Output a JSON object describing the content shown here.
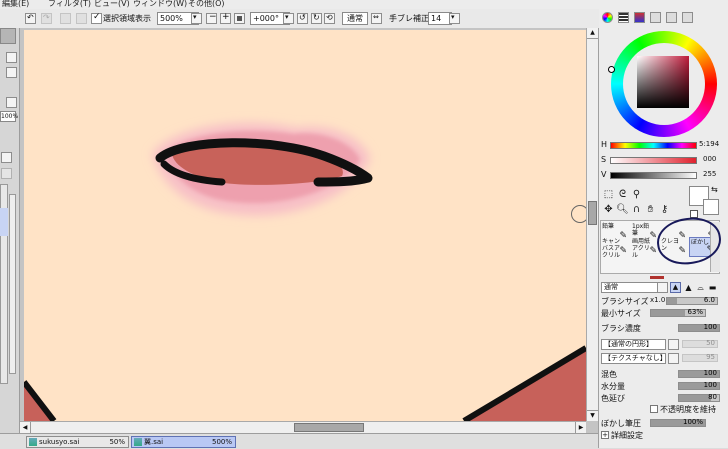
{
  "menu": [
    "編集(E)",
    "フィルタ(T)",
    "ビュー(V)",
    "ウィンドウ(W)",
    "その他(O)"
  ],
  "toolbar": {
    "selection_checkbox_label": "選択領域表示",
    "zoom": "500%",
    "rotation": "+000°",
    "blend_mode": "通常",
    "stabilizer_label": "手ブレ補正",
    "stabilizer_value": "14"
  },
  "left_panel": {
    "value": "100%"
  },
  "color": {
    "h_label": "H",
    "h_value": "5:194",
    "s_label": "S",
    "s_value": "000",
    "v_label": "V",
    "v_value": "255",
    "wheel_color": "#c03a56",
    "square_color": "#c01c3c"
  },
  "brush_tools": [
    {
      "label": "鉛筆",
      "selected": false
    },
    {
      "label": "1px鉛筆",
      "selected": false
    },
    {
      "label": "",
      "selected": false
    },
    {
      "label": "",
      "selected": false
    },
    {
      "label": "キャンバスアクリル",
      "selected": false
    },
    {
      "label": "画用紙アクリル",
      "selected": false
    },
    {
      "label": "クレヨン",
      "selected": false
    },
    {
      "label": "ぼかし",
      "selected": true
    }
  ],
  "brush_settings": {
    "mode": "通常",
    "size_label": "ブラシサイズ",
    "size_multiplier": "x1.0",
    "size_value": "6.0",
    "min_size_label": "最小サイズ",
    "min_size_value": "63%",
    "density_label": "ブラシ濃度",
    "density_value": "100",
    "shape": "【通常の円形】",
    "shape_value": "50",
    "texture": "【テクスチャなし】",
    "texture_value": "95",
    "mix_label": "混色",
    "mix_value": "100",
    "water_label": "水分量",
    "water_value": "100",
    "color_stretch_label": "色延び",
    "color_stretch_value": "80",
    "keep_opacity_label": "不透明度を維持",
    "blur_pressure_label": "ぼかし筆圧",
    "blur_pressure_value": "100%",
    "details_label": "詳細設定"
  },
  "tabs": [
    {
      "name": "sukusyo.sai",
      "zoom": "50%"
    },
    {
      "name": "翼.sai",
      "zoom": "500%"
    }
  ]
}
